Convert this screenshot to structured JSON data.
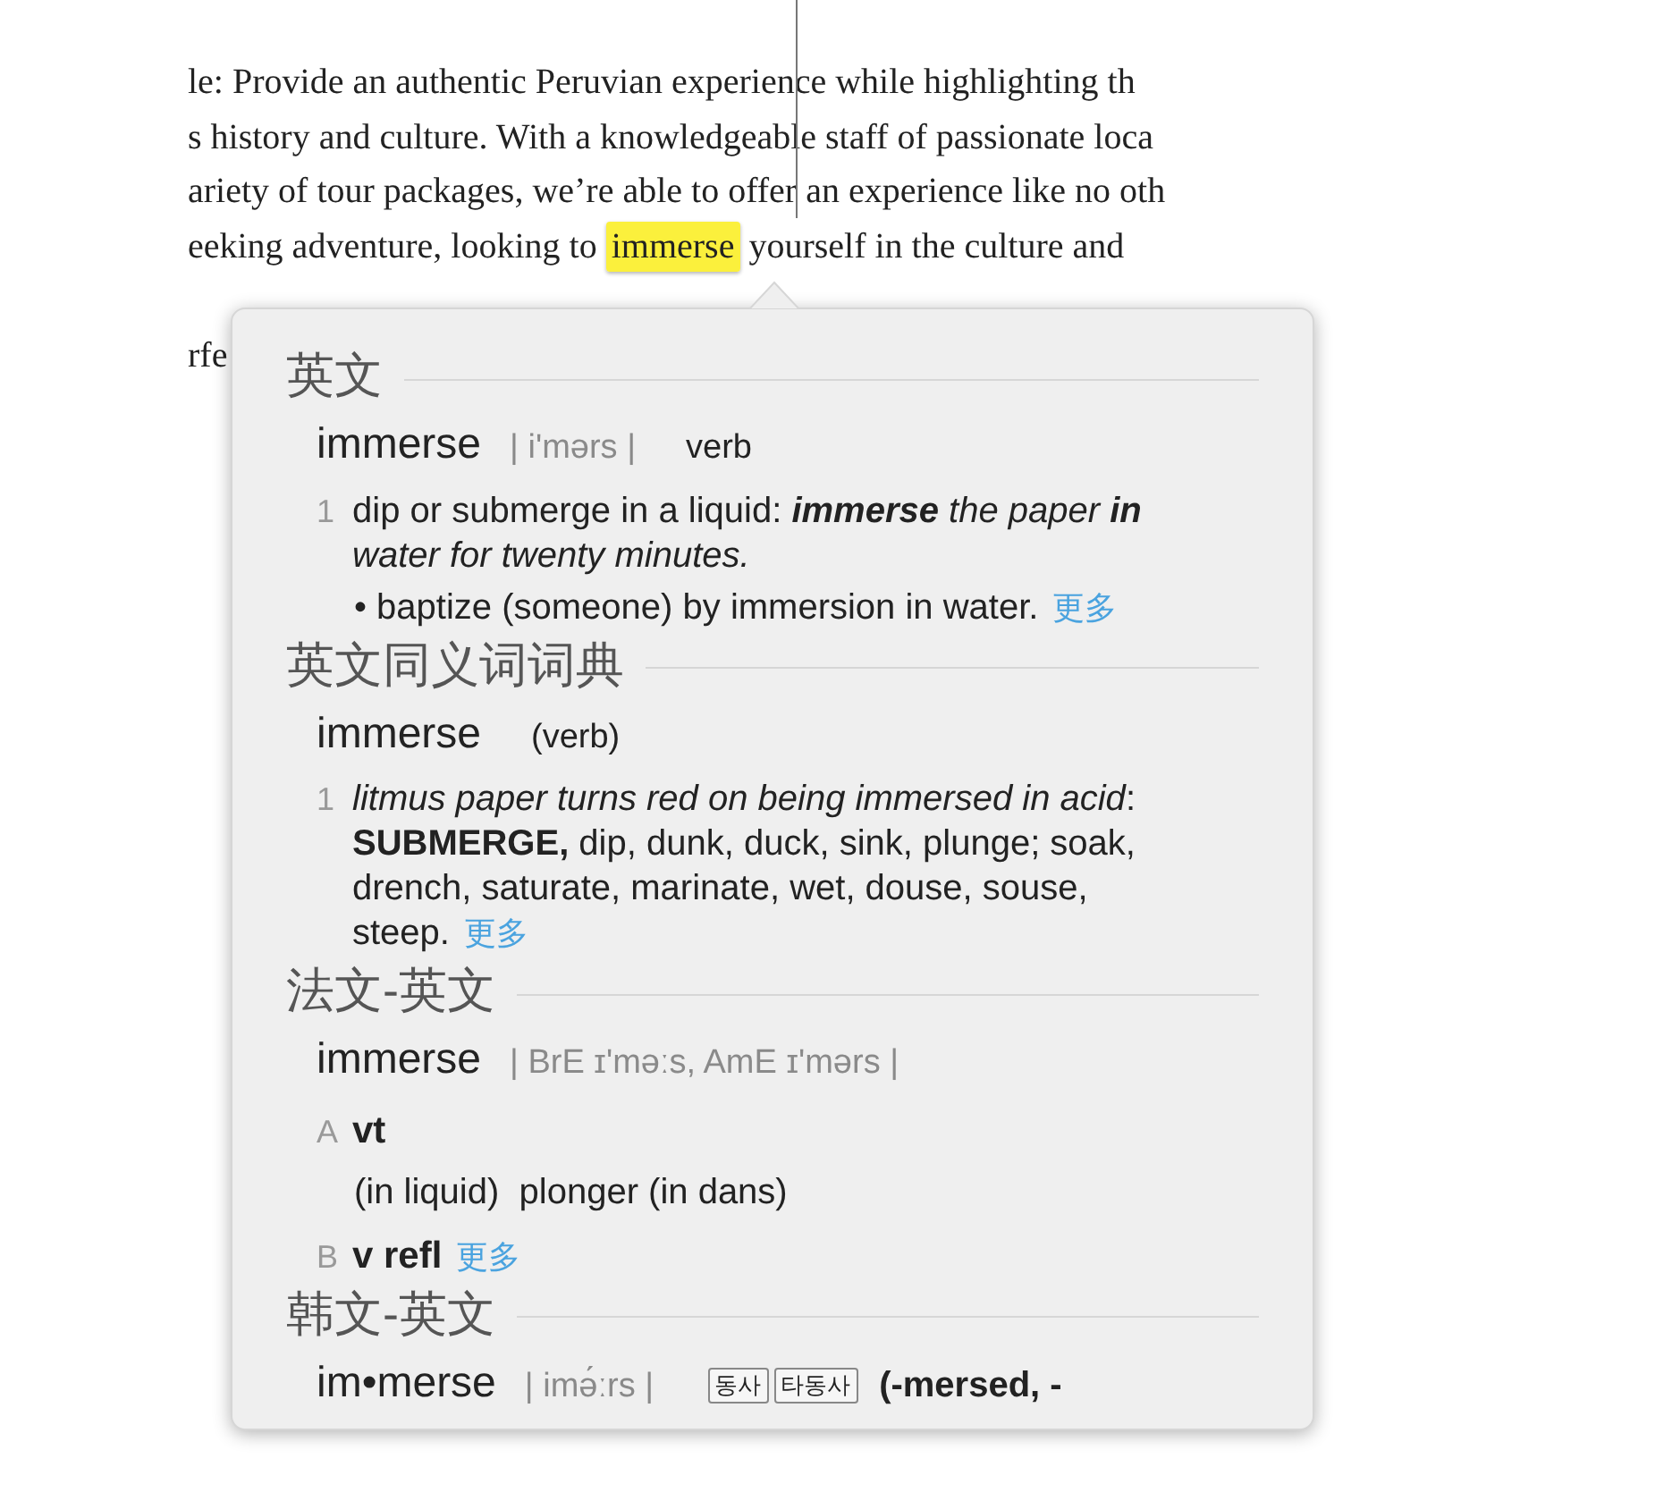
{
  "passage": {
    "lines": [
      {
        "text": "le: Provide an authentic Peruvian experience while highlighting th"
      },
      {
        "text": "s history and culture. With a knowledgeable staff of passionate loca"
      },
      {
        "text": "ariety of tour packages, we’re able to offer an experience like no oth"
      },
      {
        "before": "eeking adventure, looking to ",
        "highlight": "immerse",
        "after": " yourself in the culture and"
      },
      {
        "text": "rfe"
      }
    ]
  },
  "popup": {
    "sections": [
      {
        "heading": "英文",
        "headword": "immerse",
        "pronunciation": "| i'mərs |",
        "pos": "verb",
        "blocks": [
          {
            "kind": "sense",
            "number": "1",
            "parts": [
              {
                "kind": "definition",
                "text": "dip or submerge in a liquid: "
              },
              {
                "kind": "example",
                "text": "**immerse** the paper **in** water for twenty minutes."
              }
            ]
          },
          {
            "kind": "subsense",
            "text": "• baptize (someone) by immersion in water.",
            "more": "更多"
          }
        ]
      },
      {
        "heading": "英文同义词词典",
        "headword": "immerse",
        "pos": "(verb)",
        "blocks": [
          {
            "kind": "sense",
            "number": "1",
            "parts": [
              {
                "kind": "example",
                "text": "litmus paper turns red on being immersed in acid"
              },
              {
                "kind": "definition",
                "text": ": **SUBMERGE,** dip, dunk, duck, sink, plunge; soak, drench, saturate, marinate, wet, douse, souse, steep."
              }
            ],
            "more": "更多"
          }
        ]
      },
      {
        "heading": "法文-英文",
        "headword": "immerse",
        "pronunciation": "| BrE ɪ'məːs,  AmE ɪ'mərs |",
        "blocks": [
          {
            "kind": "label",
            "letter": "A",
            "text": "vt"
          },
          {
            "kind": "translation",
            "text": "(in liquid)  plonger (in dans)"
          },
          {
            "kind": "label",
            "letter": "B",
            "text": "v refl",
            "more": "更多"
          }
        ]
      },
      {
        "heading": "韩文-英文",
        "headword": "im•merse",
        "pronunciation": "| imə́ːrs |",
        "tags": [
          "동사",
          "타동사"
        ],
        "inflection": "(-mersed, -"
      }
    ]
  }
}
